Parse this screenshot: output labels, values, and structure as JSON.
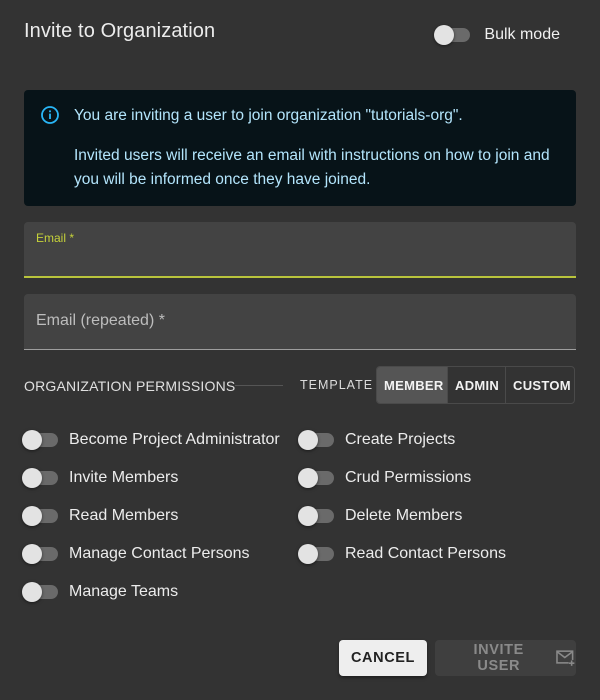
{
  "dialog": {
    "title": "Invite to Organization",
    "bulk_mode_label": "Bulk mode"
  },
  "info": {
    "icon": "info-icon",
    "line1": "You are inviting a user to join organization \"tutorials-org\".",
    "line2": "Invited users will receive an email with instructions on how to join and you will be informed once they have joined."
  },
  "fields": {
    "email_label": "Email *",
    "email_value": "",
    "email_repeat_label": "Email (repeated) *",
    "email_repeat_value": ""
  },
  "permissions": {
    "heading": "ORGANIZATION PERMISSIONS",
    "template_label": "TEMPLATE",
    "templates": [
      "MEMBER",
      "ADMIN",
      "CUSTOM"
    ],
    "selected_template": "MEMBER",
    "left": [
      "Become Project Administrator",
      "Invite Members",
      "Read Members",
      "Manage Contact Persons",
      "Manage Teams"
    ],
    "right": [
      "Create Projects",
      "Crud Permissions",
      "Delete Members",
      "Read Contact Persons"
    ]
  },
  "actions": {
    "cancel_label": "CANCEL",
    "invite_label": "INVITE USER",
    "invite_icon": "mail-plus-icon"
  },
  "colors": {
    "accent": "#c5d13a",
    "info_background": "#071318",
    "info_text": "#b3e5fc"
  }
}
